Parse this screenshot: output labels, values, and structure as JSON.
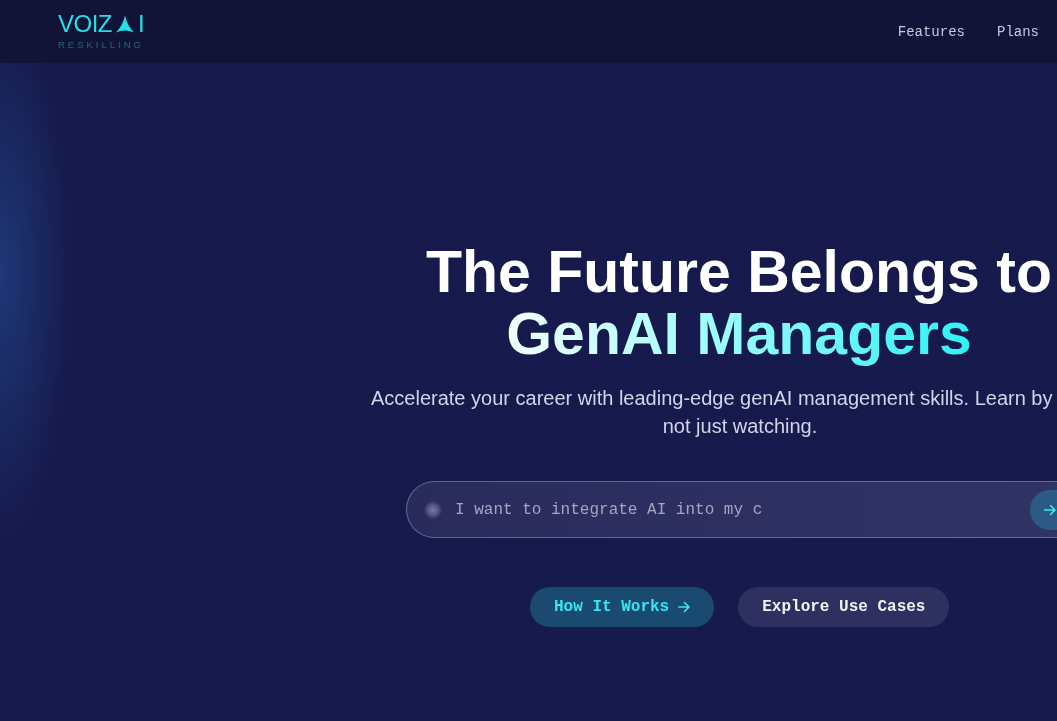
{
  "header": {
    "logo": {
      "wordmark": "VOIZ",
      "wordmark_end": "I",
      "tagline": "RESKILLING"
    },
    "nav": [
      "Features",
      "Plans"
    ]
  },
  "hero": {
    "heading": {
      "line_1": "The Future Belongs to",
      "highlight": "GenAI Managers"
    },
    "subtitle_lines": [
      "Accelerate your career with leading-edge genAI management skills. Learn by",
      "not just watching."
    ],
    "prompt": {
      "placeholder": "I want to integrate AI into my c"
    },
    "buttons": [
      {
        "label": "How It Works",
        "kind": "primary"
      },
      {
        "label": "Explore Use Cases",
        "kind": "secondary"
      }
    ]
  }
}
